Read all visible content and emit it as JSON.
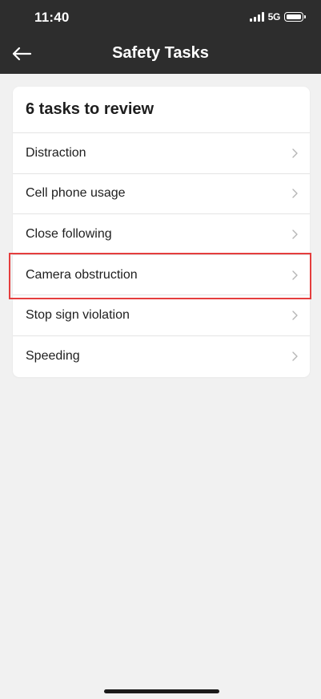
{
  "status_bar": {
    "time": "11:40",
    "network": "5G"
  },
  "nav": {
    "back_icon": "arrow-left-icon",
    "title": "Safety Tasks"
  },
  "card": {
    "title": "6 tasks to review",
    "tasks": [
      {
        "label": "Distraction"
      },
      {
        "label": "Cell phone usage"
      },
      {
        "label": "Close following"
      },
      {
        "label": "Camera obstruction",
        "highlighted": true
      },
      {
        "label": "Stop sign violation"
      },
      {
        "label": "Speeding"
      }
    ]
  },
  "colors": {
    "header_bg": "#2d2d2d",
    "page_bg": "#f1f1f1",
    "card_bg": "#ffffff",
    "highlight": "#e53e3e",
    "chevron": "#b5b5b5"
  }
}
